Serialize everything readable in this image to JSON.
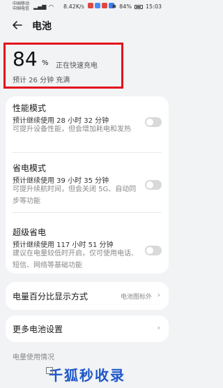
{
  "status_bar": {
    "carrier1": "中国移动",
    "carrier2": "中国电信",
    "net_speed": "8.42K/s",
    "battery_percent": "84%",
    "time": "15:03"
  },
  "header": {
    "title": "电池"
  },
  "battery": {
    "level": "84",
    "unit": "%",
    "status": "正在快速充电",
    "estimate": "预计 26 分钟 充满"
  },
  "modes": [
    {
      "title": "性能模式",
      "sub": "预计继续使用 28 小时 32 分钟",
      "desc": "可提升设备性能，但会增加耗电和发热",
      "enabled": false
    },
    {
      "title": "省电模式",
      "sub": "预计继续使用 39 小时 35 分钟",
      "desc": "可提升续航时间，但会关闭 5G、自动同步等功能",
      "enabled": false
    },
    {
      "title": "超级省电",
      "sub": "预计继续使用 117 小时 51 分钟",
      "desc": "建议在电量较低时开启，仅可使用电话、短信、网络等基础功能",
      "enabled": false
    }
  ],
  "percent_display": {
    "label": "电量百分比显示方式",
    "value": "电池图标外"
  },
  "more_settings": {
    "label": "更多电池设置"
  },
  "usage_section": {
    "label": "电量使用情况"
  },
  "watermark": {
    "text": "千狐秒收录"
  },
  "colors": {
    "highlight_border": "#e30f1c",
    "background": "#f1f3f5",
    "watermark": "#1f57c8"
  }
}
